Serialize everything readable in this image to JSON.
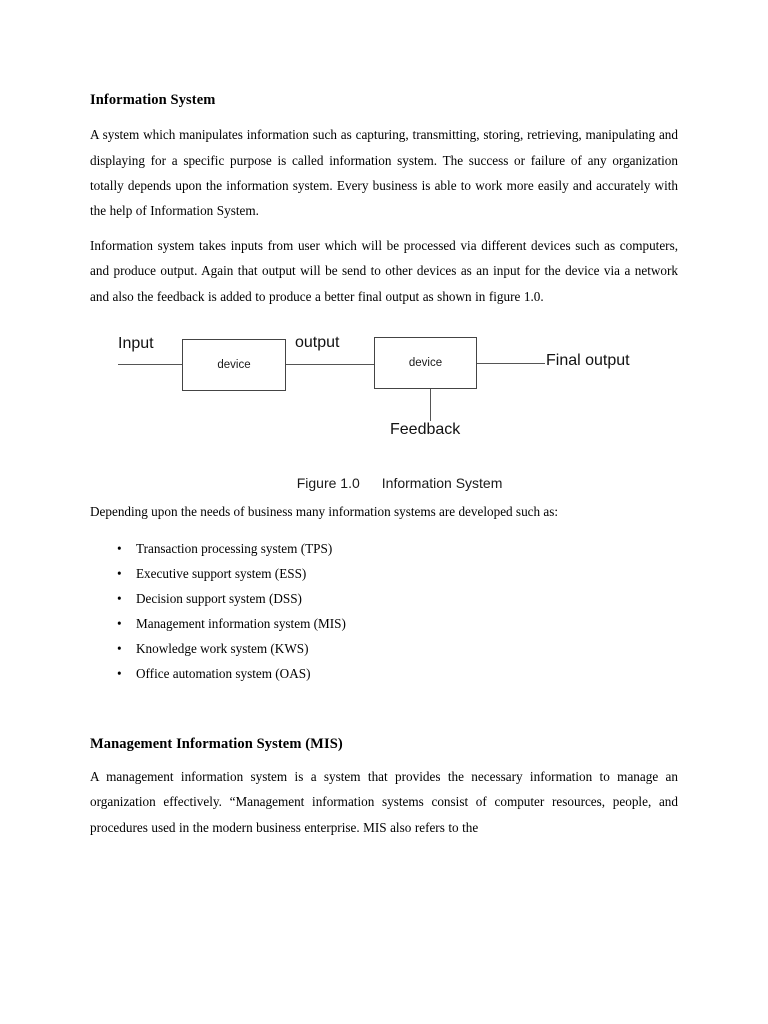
{
  "document": {
    "sections": [
      {
        "heading": "Information System",
        "paragraphs": [
          "A system which manipulates information such as capturing, transmitting, storing, retrieving, manipulating and displaying for a specific purpose is called information system. The success or failure of any organization totally depends upon the information system. Every business is able to work more easily and accurately with the help of Information System.",
          "Information system takes inputs from user which will be processed via different devices such as computers, and produce output. Again that output will be send to other devices as an input for the device via a network and also the feedback is added to produce a better final output as shown in figure 1.0."
        ]
      }
    ],
    "figure": {
      "caption_number": "Figure 1.0",
      "caption_title": "Information System",
      "labels": {
        "input": "Input",
        "output": "output",
        "final_output": "Final output",
        "feedback": "Feedback",
        "device_one": "device",
        "device_two": "device"
      },
      "stroke_color": "#555555"
    },
    "list_intro": "Depending upon the needs of business many information systems are developed such as:",
    "bullet_marker": "•",
    "list_items": [
      "Transaction processing system (TPS)",
      "Executive support system (ESS)",
      "Decision support system (DSS)",
      "Management information system (MIS)",
      "Knowledge work system (KWS)",
      "Office automation system (OAS)"
    ],
    "mis_section": {
      "heading": "Management Information System (MIS)",
      "paragraph": "A management information system is a system that provides the necessary information to manage an organization effectively. “Management information systems consist of computer resources, people, and procedures used in the modern business enterprise. MIS also refers to the"
    }
  }
}
